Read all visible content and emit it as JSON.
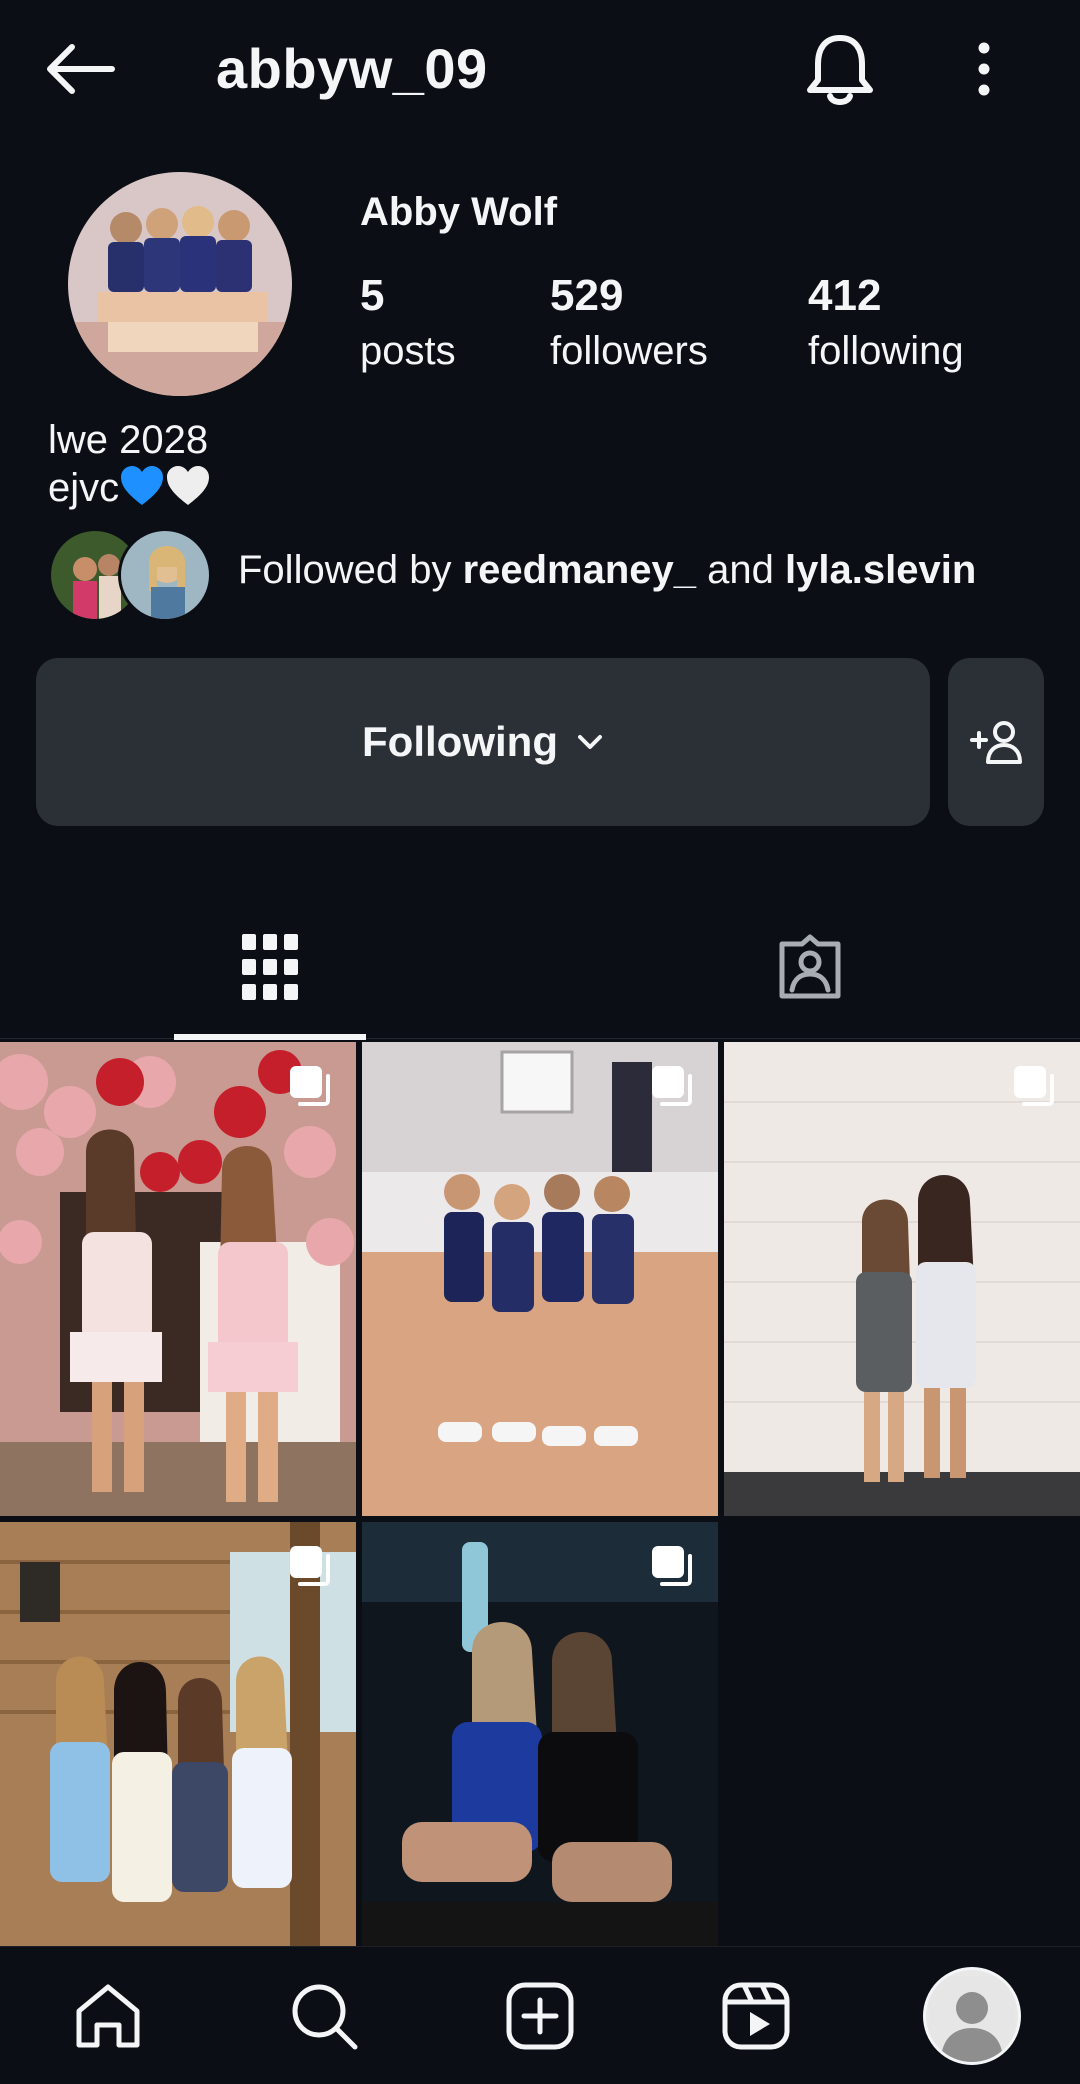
{
  "header": {
    "username": "abbyw_09"
  },
  "profile": {
    "name": "Abby Wolf",
    "stats": [
      {
        "value": "5",
        "label": "posts"
      },
      {
        "value": "529",
        "label": "followers"
      },
      {
        "value": "412",
        "label": "following"
      }
    ],
    "bio_lines": [
      "lwe 2028",
      "ejvc"
    ],
    "followed_by": {
      "prefix": "Followed by",
      "user1": "reedmaney_",
      "conj": "and",
      "user2": "lyla.slevin"
    }
  },
  "actions": {
    "following_label": "Following"
  },
  "tabs": [
    {
      "name": "posts-grid",
      "icon": "grid-icon",
      "active": true
    },
    {
      "name": "tagged",
      "icon": "tagged-person-icon",
      "active": false
    }
  ],
  "posts_count_shown": 5,
  "nav": [
    "home-icon",
    "search-icon",
    "create-icon",
    "reels-icon",
    "profile-avatar"
  ],
  "colors": {
    "background": "#0b0e14",
    "button": "#2b2f36",
    "text": "#f3f5f7",
    "blue_heart": "#1e90ff"
  }
}
